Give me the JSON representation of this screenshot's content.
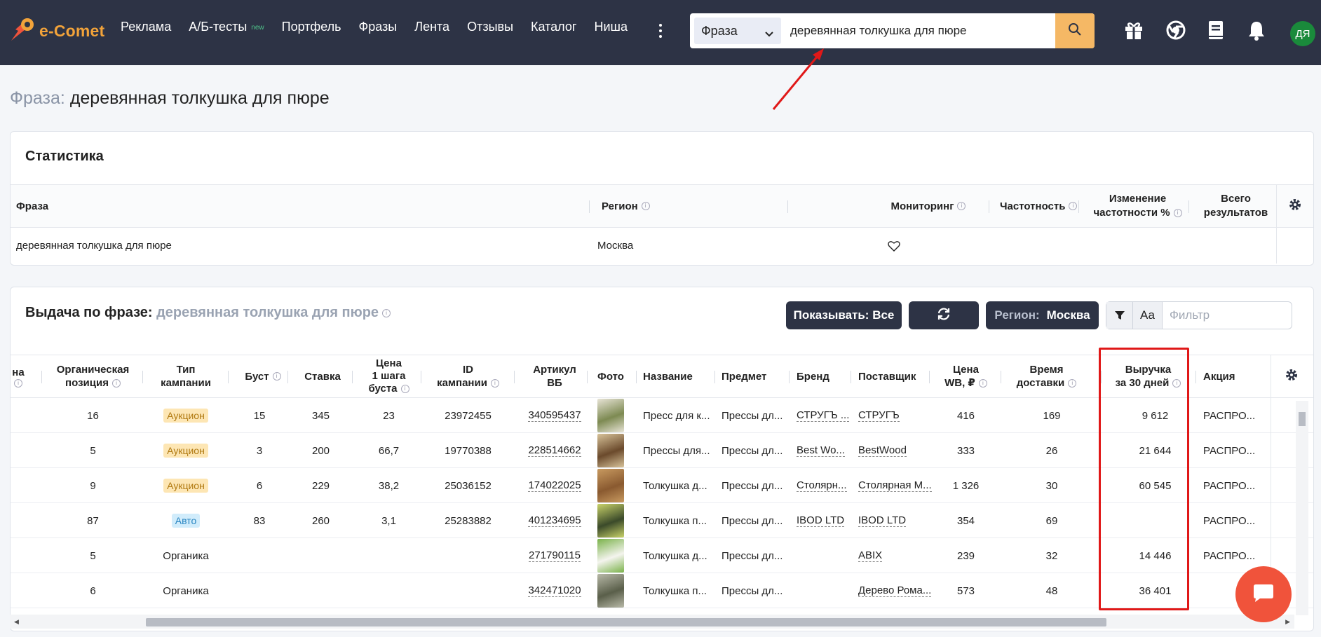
{
  "app": {
    "name": "e-Comet"
  },
  "nav": {
    "items": [
      {
        "label": "Реклама",
        "badge": ""
      },
      {
        "label": "А/Б-тесты",
        "badge": "new"
      },
      {
        "label": "Портфель",
        "badge": ""
      },
      {
        "label": "Фразы",
        "badge": ""
      },
      {
        "label": "Лента",
        "badge": ""
      },
      {
        "label": "Отзывы",
        "badge": ""
      },
      {
        "label": "Каталог",
        "badge": ""
      },
      {
        "label": "Ниша",
        "badge": ""
      }
    ]
  },
  "search": {
    "type_selected": "Фраза",
    "value": "деревянная толкушка для пюре"
  },
  "user": {
    "initials": "ДЯ"
  },
  "page": {
    "title_prefix": "Фраза:",
    "title": "деревянная толкушка для пюре"
  },
  "stats": {
    "title": "Статистика",
    "headers": {
      "phrase": "Фраза",
      "region": "Регион",
      "monitoring": "Мониторинг",
      "frequency": "Частотность",
      "freq_change_1": "Изменение",
      "freq_change_2": "частотности %",
      "total_1": "Всего",
      "total_2": "результатов"
    },
    "row": {
      "phrase": "деревянная толкушка для пюре",
      "region": "Москва",
      "frequency": "",
      "freq_change": "",
      "total": ""
    }
  },
  "results": {
    "title_prefix": "Выдача по фразе:",
    "phrase": "деревянная толкушка для пюре",
    "show_label": "Показывать: Все",
    "region_label": "Регион:",
    "region_value": "Москва",
    "filter_aa": "Аа",
    "filter_placeholder": "Фильтр",
    "headers": {
      "cut": "на",
      "organic_1": "Органическая",
      "organic_2": "позиция",
      "ctype_1": "Тип",
      "ctype_2": "кампании",
      "boost": "Буст",
      "bid": "Ставка",
      "price_step_1": "Цена",
      "price_step_2": "1 шага",
      "price_step_3": "буста",
      "cid_1": "ID",
      "cid_2": "кампании",
      "art_1": "Артикул",
      "art_2": "ВБ",
      "photo": "Фото",
      "name": "Название",
      "subject": "Предмет",
      "brand": "Бренд",
      "supplier": "Поставщик",
      "price_1": "Цена",
      "price_2": "WB, ₽",
      "delivery_1": "Время",
      "delivery_2": "доставки",
      "revenue_1": "Выручка",
      "revenue_2": "за 30 дней",
      "promo": "Акция"
    },
    "rows": [
      {
        "org": "16",
        "ctype": "Аукцион",
        "ckind": "auc",
        "boost": "15",
        "bid": "345",
        "step": "23",
        "cid": "23972455",
        "art": "340595437",
        "name": "Пресс для к...",
        "subject": "Прессы дл...",
        "brand": "СТРУГЪ ...",
        "supplier": "СТРУГЪ",
        "price": "416",
        "delivery": "169",
        "revenue": "9 612",
        "promo": "РАСПРО..."
      },
      {
        "org": "5",
        "ctype": "Аукцион",
        "ckind": "auc",
        "boost": "3",
        "bid": "200",
        "step": "66,7",
        "cid": "19770388",
        "art": "228514662",
        "name": "Прессы для...",
        "subject": "Прессы дл...",
        "brand": "Best Wo...",
        "supplier": "BestWood",
        "price": "333",
        "delivery": "26",
        "revenue": "21 644",
        "promo": "РАСПРО..."
      },
      {
        "org": "9",
        "ctype": "Аукцион",
        "ckind": "auc",
        "boost": "6",
        "bid": "229",
        "step": "38,2",
        "cid": "25036152",
        "art": "174022025",
        "name": "Толкушка д...",
        "subject": "Прессы дл...",
        "brand": "Столярн...",
        "supplier": "Столярная М...",
        "price": "1 326",
        "delivery": "30",
        "revenue": "60 545",
        "promo": "РАСПРО..."
      },
      {
        "org": "87",
        "ctype": "Авто",
        "ckind": "auto",
        "boost": "83",
        "bid": "260",
        "step": "3,1",
        "cid": "25283882",
        "art": "401234695",
        "name": "Толкушка п...",
        "subject": "Прессы дл...",
        "brand": "IBOD LTD",
        "supplier": "IBOD LTD",
        "price": "354",
        "delivery": "69",
        "revenue": "",
        "promo": "РАСПРО..."
      },
      {
        "org": "5",
        "ctype": "Органика",
        "ckind": "org",
        "boost": "",
        "bid": "",
        "step": "",
        "cid": "",
        "art": "271790115",
        "name": "Толкушка д...",
        "subject": "Прессы дл...",
        "brand": "",
        "supplier": "ABIX",
        "price": "239",
        "delivery": "32",
        "revenue": "14 446",
        "promo": "РАСПРО..."
      },
      {
        "org": "6",
        "ctype": "Органика",
        "ckind": "org",
        "boost": "",
        "bid": "",
        "step": "",
        "cid": "",
        "art": "342471020",
        "name": "Толкушка п...",
        "subject": "Прессы дл...",
        "brand": "",
        "supplier": "Дерево Рома...",
        "price": "573",
        "delivery": "48",
        "revenue": "36 401",
        "promo": ""
      }
    ]
  },
  "colors": {
    "topbar": "#2d3345",
    "accent": "#f5b865",
    "highlight": "#e01818",
    "chat": "#f0533b"
  }
}
